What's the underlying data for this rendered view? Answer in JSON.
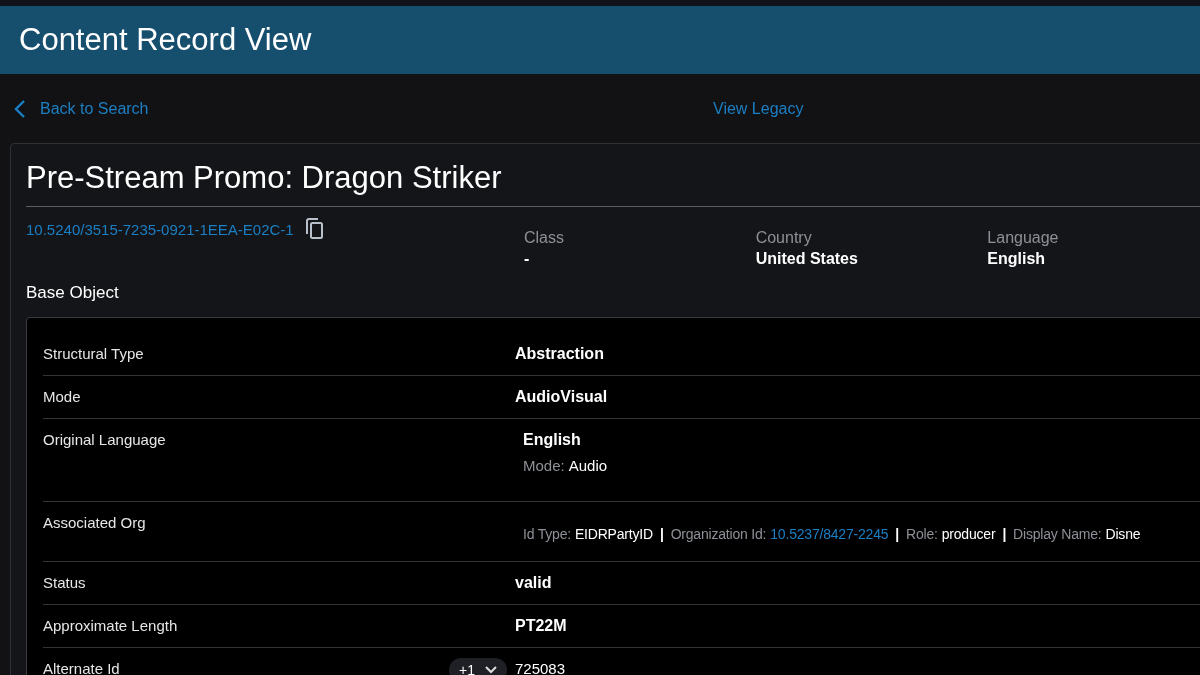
{
  "header": {
    "title": "Content Record View"
  },
  "nav": {
    "back": "Back to Search",
    "legacy": "View Legacy"
  },
  "record": {
    "title": "Pre-Stream Promo: Dragon Striker",
    "id": "10.5240/3515-7235-0921-1EEA-E02C-1",
    "meta": [
      {
        "label": "Class",
        "value": "-"
      },
      {
        "label": "Country",
        "value": "United States"
      },
      {
        "label": "Language",
        "value": "English"
      }
    ],
    "section": "Base Object",
    "rows": [
      {
        "kind": "text",
        "label": "Structural Type",
        "value": "Abstraction"
      },
      {
        "kind": "text",
        "label": "Mode",
        "value": "AudioVisual"
      },
      {
        "kind": "language",
        "label": "Original Language",
        "value": "English",
        "mode_label": "Mode:",
        "mode": "Audio"
      },
      {
        "kind": "org",
        "label": "Associated Org",
        "separator": "|",
        "parts": [
          {
            "label": "Id Type:",
            "value": "EIDRPartyID",
            "link": false
          },
          {
            "label": "Organization Id:",
            "value": "10.5237/8427-2245",
            "link": true
          },
          {
            "label": "Role:",
            "value": "producer",
            "link": false
          },
          {
            "label": "Display Name:",
            "value": "Disne",
            "link": false
          }
        ]
      },
      {
        "kind": "text",
        "label": "Status",
        "value": "valid"
      },
      {
        "kind": "text",
        "label": "Approximate Length",
        "value": "PT22M"
      },
      {
        "kind": "chip",
        "label": "Alternate Id",
        "chip": "+1",
        "value": "725083"
      }
    ]
  }
}
